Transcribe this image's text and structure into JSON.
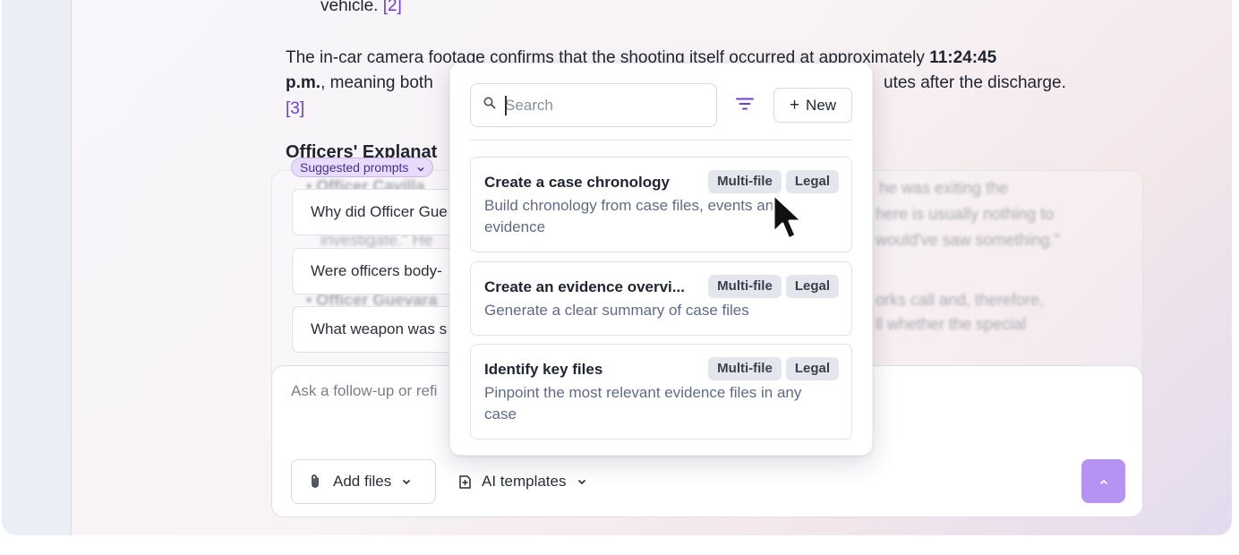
{
  "document": {
    "line_vehicle": "vehicle.",
    "ref_2": "[2]",
    "para_line1_pre": "The in-car camera footage confirms that the shooting itself occurred at approximately ",
    "para_line1_bold": "11:24:45",
    "para_line2_bold": "p.m.",
    "para_line2_pre": ", meaning both",
    "para_line2_post": "utes after the discharge.",
    "ref_3": "[3]",
    "heading": "Officers' Explanat",
    "blurred_lines": [
      "• Officer Cavilla",
      "he was exiting the",
      "investigate.\" He",
      "here is usually nothing to",
      "would've saw something.\"",
      "• Officer Guevara",
      "orks call and, therefore,",
      "ll whether the special"
    ]
  },
  "suggested_prompts": {
    "label": "Suggested prompts",
    "items": [
      "Why did Officer Gue",
      "Were officers body-",
      "What weapon was s"
    ]
  },
  "composer": {
    "placeholder": "Ask a follow-up or refi",
    "add_files_label": "Add files",
    "ai_templates_label": "AI templates"
  },
  "templates_dropdown": {
    "search_placeholder": "Search",
    "new_label": "New",
    "templates": [
      {
        "title": "Create a case chronology",
        "description": "Build chronology from case files, events and evidence",
        "tags": [
          "Multi-file",
          "Legal"
        ]
      },
      {
        "title": "Create an evidence overvi...",
        "description": "Generate a clear summary of case files",
        "tags": [
          "Multi-file",
          "Legal"
        ]
      },
      {
        "title": "Identify key files",
        "description": "Pinpoint the most relevant evidence files in any case",
        "tags": [
          "Multi-file",
          "Legal"
        ]
      }
    ]
  },
  "colors": {
    "accent": "#6b3fd6",
    "send_button": "#b493f3",
    "pill_bg": "#e7dcfb"
  },
  "icons": {
    "search": "search-icon",
    "filter": "filter-icon",
    "paperclip": "paperclip-icon",
    "template": "template-icon",
    "chevron": "chevron-down-icon",
    "send": "chevron-up-icon",
    "cursor": "mouse-pointer-icon"
  }
}
